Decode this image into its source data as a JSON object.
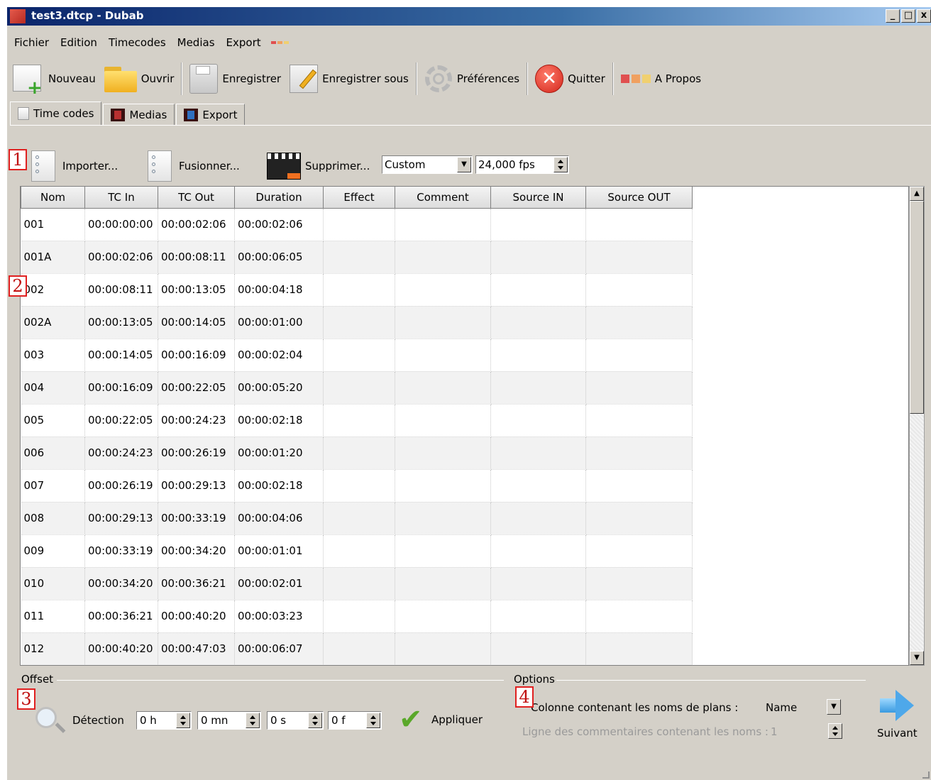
{
  "window": {
    "title": "test3.dtcp - Dubab",
    "controls": [
      "_",
      "□",
      "x"
    ]
  },
  "menu": [
    "Fichier",
    "Edition",
    "Timecodes",
    "Medias",
    "Export"
  ],
  "toolbar": {
    "nouveau": "Nouveau",
    "ouvrir": "Ouvrir",
    "enregistrer": "Enregistrer",
    "enregistrer_sous": "Enregistrer sous",
    "preferences": "Préférences",
    "quitter": "Quitter",
    "a_propos": "A Propos"
  },
  "tabs": [
    "Time codes",
    "Medias",
    "Export"
  ],
  "actions": {
    "importer": "Importer...",
    "fusionner": "Fusionner...",
    "supprimer": "Supprimer...",
    "format_select": "Custom",
    "fps": "24,000 fps"
  },
  "table": {
    "columns": [
      "Nom",
      "TC In",
      "TC Out",
      "Duration",
      "Effect",
      "Comment",
      "Source IN",
      "Source OUT"
    ],
    "rows": [
      [
        "001",
        "00:00:00:00",
        "00:00:02:06",
        "00:00:02:06",
        "",
        "",
        "",
        ""
      ],
      [
        "001A",
        "00:00:02:06",
        "00:00:08:11",
        "00:00:06:05",
        "",
        "",
        "",
        ""
      ],
      [
        "002",
        "00:00:08:11",
        "00:00:13:05",
        "00:00:04:18",
        "",
        "",
        "",
        ""
      ],
      [
        "002A",
        "00:00:13:05",
        "00:00:14:05",
        "00:00:01:00",
        "",
        "",
        "",
        ""
      ],
      [
        "003",
        "00:00:14:05",
        "00:00:16:09",
        "00:00:02:04",
        "",
        "",
        "",
        ""
      ],
      [
        "004",
        "00:00:16:09",
        "00:00:22:05",
        "00:00:05:20",
        "",
        "",
        "",
        ""
      ],
      [
        "005",
        "00:00:22:05",
        "00:00:24:23",
        "00:00:02:18",
        "",
        "",
        "",
        ""
      ],
      [
        "006",
        "00:00:24:23",
        "00:00:26:19",
        "00:00:01:20",
        "",
        "",
        "",
        ""
      ],
      [
        "007",
        "00:00:26:19",
        "00:00:29:13",
        "00:00:02:18",
        "",
        "",
        "",
        ""
      ],
      [
        "008",
        "00:00:29:13",
        "00:00:33:19",
        "00:00:04:06",
        "",
        "",
        "",
        ""
      ],
      [
        "009",
        "00:00:33:19",
        "00:00:34:20",
        "00:00:01:01",
        "",
        "",
        "",
        ""
      ],
      [
        "010",
        "00:00:34:20",
        "00:00:36:21",
        "00:00:02:01",
        "",
        "",
        "",
        ""
      ],
      [
        "011",
        "00:00:36:21",
        "00:00:40:20",
        "00:00:03:23",
        "",
        "",
        "",
        ""
      ],
      [
        "012",
        "00:00:40:20",
        "00:00:47:03",
        "00:00:06:07",
        "",
        "",
        "",
        ""
      ]
    ]
  },
  "offset": {
    "label": "Offset",
    "detection": "Détection",
    "hours": "0 h",
    "minutes": "0 mn",
    "seconds": "0 s",
    "frames": "0 f",
    "apply": "Appliquer"
  },
  "options": {
    "label": "Options",
    "names_column_label": "Colonne contenant les noms de plans :",
    "names_column_value": "Name",
    "comments_line_label": "Ligne des commentaires contenant les noms :",
    "comments_line_value": "1",
    "next": "Suivant"
  },
  "markers": [
    "1",
    "2",
    "3",
    "4"
  ],
  "colors": {
    "title_start": "#0a246a",
    "title_end": "#a6caf0",
    "marker": "#e02020",
    "window_bg": "#d4d0c8"
  }
}
